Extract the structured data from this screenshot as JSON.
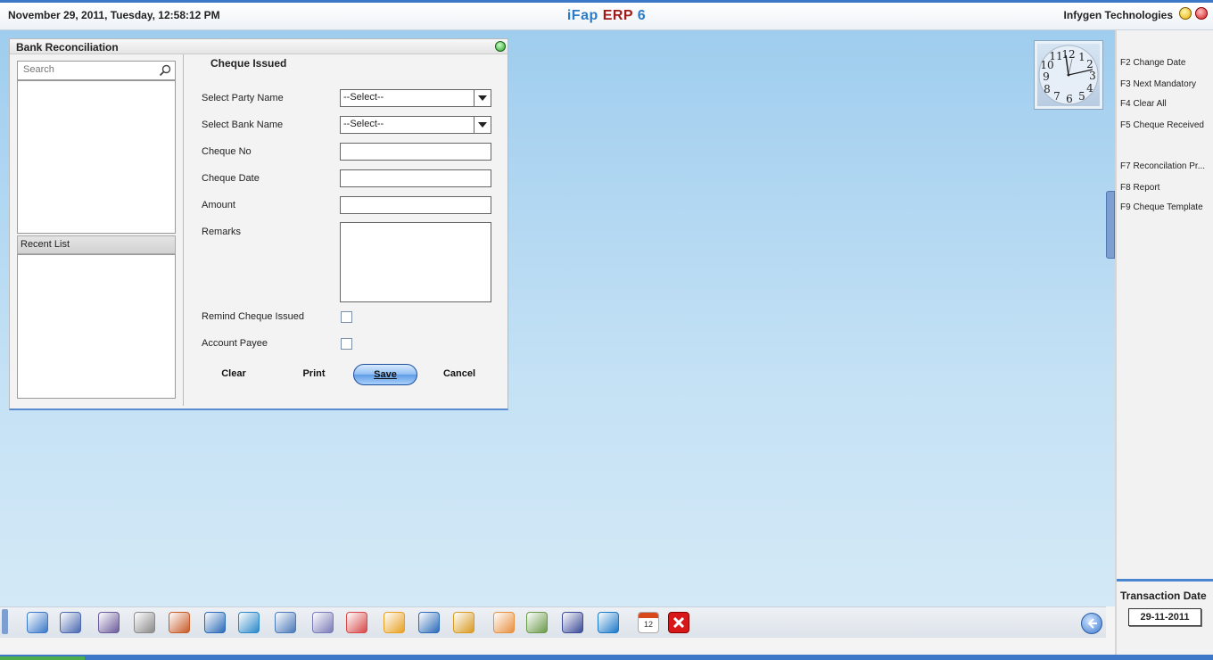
{
  "header": {
    "datetime": "November  29, 2011, Tuesday, 12:58:12 PM",
    "app_title_part1": "iFap",
    "app_title_part2": "ERP",
    "app_title_part3": "6",
    "company": "Infygen Technologies"
  },
  "dialog": {
    "title": "Bank Reconciliation",
    "search_placeholder": "Search",
    "recent_list_label": "Recent List",
    "form_title": "Cheque Issued",
    "fields": {
      "party_label": "Select Party Name",
      "party_value": "--Select--",
      "bank_label": "Select Bank Name",
      "bank_value": "--Select--",
      "cheque_no_label": "Cheque No",
      "cheque_date_label": "Cheque Date",
      "amount_label": "Amount",
      "remarks_label": "Remarks",
      "remind_label": "Remind Cheque Issued",
      "payee_label": "Account Payee"
    },
    "buttons": {
      "clear": "Clear",
      "print": "Print",
      "save": "Save",
      "cancel": "Cancel"
    }
  },
  "shortcuts": [
    "F2 Change Date",
    "F3 Next Mandatory",
    "F4 Clear All",
    "F5 Cheque Received",
    "F7 Reconcilation Pr...",
    "F8 Report",
    "F9 Cheque Template"
  ],
  "transaction": {
    "label": "Transaction Date",
    "date": "29-11-2011"
  },
  "taskbar_icons": [
    {
      "name": "journal-icon",
      "color": "#3a78c8"
    },
    {
      "name": "user-edit-icon",
      "color": "#4a68b0"
    },
    {
      "name": "users-icon",
      "color": "#6a5a9a"
    },
    {
      "name": "settings-icon",
      "color": "#8a8a8a"
    },
    {
      "name": "books-icon",
      "color": "#c85a28"
    },
    {
      "name": "cart-icon",
      "color": "#2a6ab8"
    },
    {
      "name": "transfer-icon",
      "color": "#2a88c8"
    },
    {
      "name": "window-icon",
      "color": "#4a78b8"
    },
    {
      "name": "document-icon",
      "color": "#7a7ab8"
    },
    {
      "name": "chart-icon",
      "color": "#d84848"
    },
    {
      "name": "folder-tree-icon",
      "color": "#e8a020"
    },
    {
      "name": "network-icon",
      "color": "#2a6ab8"
    },
    {
      "name": "package-icon",
      "color": "#d89a20"
    },
    {
      "name": "dashboard-icon",
      "color": "#e89040"
    },
    {
      "name": "spreadsheet-icon",
      "color": "#6a9a4a"
    },
    {
      "name": "database-icon",
      "color": "#3a4a98"
    },
    {
      "name": "gear-icon",
      "color": "#1a78c8"
    },
    {
      "name": "calendar-icon",
      "color": "#d84818"
    },
    {
      "name": "exit-icon",
      "color": "#d81818"
    }
  ],
  "calendar_day": "12"
}
